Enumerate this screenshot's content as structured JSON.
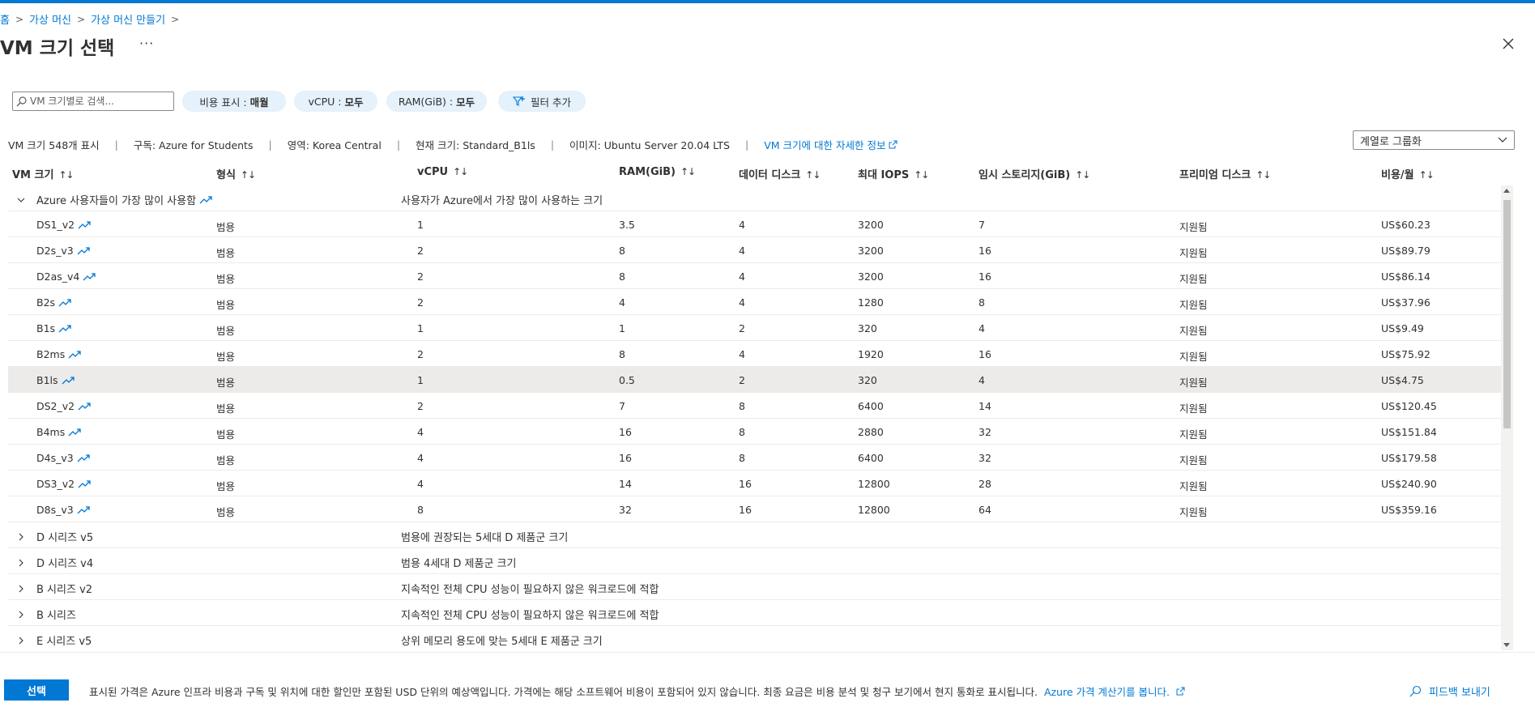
{
  "breadcrumb": {
    "items": [
      "홈",
      "가상 머신",
      "가상 머신 만들기"
    ]
  },
  "title": "VM 크기 선택",
  "more_label": "···",
  "search": {
    "placeholder": "VM 크기별로 검색...",
    "value": ""
  },
  "filters": {
    "cost": {
      "label": "비용 표시 :",
      "value": "매월"
    },
    "vcpu": {
      "label": "vCPU :",
      "value": "모두"
    },
    "ram": {
      "label": "RAM(GiB) :",
      "value": "모두"
    },
    "add": "필터 추가"
  },
  "info": {
    "count": "VM 크기 548개 표시",
    "subscription": "구독: Azure for Students",
    "region": "영역: Korea Central",
    "current": "현재 크기: Standard_B1ls",
    "image": "이미지: Ubuntu Server 20.04 LTS",
    "link": "VM 크기에 대한 자세한 정보"
  },
  "groupby": {
    "value": "계열로 그룹화"
  },
  "columns": [
    "VM 크기",
    "형식",
    "vCPU",
    "RAM(GiB)",
    "데이터 디스크",
    "최대 IOPS",
    "임시 스토리지(GiB)",
    "프리미엄 디스크",
    "비용/월"
  ],
  "popular_group": {
    "name": "Azure 사용자들이 가장 많이 사용함",
    "description": "사용자가 Azure에서 가장 많이 사용하는 크기",
    "rows": [
      {
        "size": "DS1_v2",
        "type": "범용",
        "vcpu": "1",
        "ram": "3.5",
        "disks": "4",
        "iops": "3200",
        "temp": "7",
        "premium": "지원됨",
        "cost": "US$60.23",
        "selected": false
      },
      {
        "size": "D2s_v3",
        "type": "범용",
        "vcpu": "2",
        "ram": "8",
        "disks": "4",
        "iops": "3200",
        "temp": "16",
        "premium": "지원됨",
        "cost": "US$89.79",
        "selected": false
      },
      {
        "size": "D2as_v4",
        "type": "범용",
        "vcpu": "2",
        "ram": "8",
        "disks": "4",
        "iops": "3200",
        "temp": "16",
        "premium": "지원됨",
        "cost": "US$86.14",
        "selected": false
      },
      {
        "size": "B2s",
        "type": "범용",
        "vcpu": "2",
        "ram": "4",
        "disks": "4",
        "iops": "1280",
        "temp": "8",
        "premium": "지원됨",
        "cost": "US$37.96",
        "selected": false
      },
      {
        "size": "B1s",
        "type": "범용",
        "vcpu": "1",
        "ram": "1",
        "disks": "2",
        "iops": "320",
        "temp": "4",
        "premium": "지원됨",
        "cost": "US$9.49",
        "selected": false
      },
      {
        "size": "B2ms",
        "type": "범용",
        "vcpu": "2",
        "ram": "8",
        "disks": "4",
        "iops": "1920",
        "temp": "16",
        "premium": "지원됨",
        "cost": "US$75.92",
        "selected": false
      },
      {
        "size": "B1ls",
        "type": "범용",
        "vcpu": "1",
        "ram": "0.5",
        "disks": "2",
        "iops": "320",
        "temp": "4",
        "premium": "지원됨",
        "cost": "US$4.75",
        "selected": true
      },
      {
        "size": "DS2_v2",
        "type": "범용",
        "vcpu": "2",
        "ram": "7",
        "disks": "8",
        "iops": "6400",
        "temp": "14",
        "premium": "지원됨",
        "cost": "US$120.45",
        "selected": false
      },
      {
        "size": "B4ms",
        "type": "범용",
        "vcpu": "4",
        "ram": "16",
        "disks": "8",
        "iops": "2880",
        "temp": "32",
        "premium": "지원됨",
        "cost": "US$151.84",
        "selected": false
      },
      {
        "size": "D4s_v3",
        "type": "범용",
        "vcpu": "4",
        "ram": "16",
        "disks": "8",
        "iops": "6400",
        "temp": "32",
        "premium": "지원됨",
        "cost": "US$179.58",
        "selected": false
      },
      {
        "size": "DS3_v2",
        "type": "범용",
        "vcpu": "4",
        "ram": "14",
        "disks": "16",
        "iops": "12800",
        "temp": "28",
        "premium": "지원됨",
        "cost": "US$240.90",
        "selected": false
      },
      {
        "size": "D8s_v3",
        "type": "범용",
        "vcpu": "8",
        "ram": "32",
        "disks": "16",
        "iops": "12800",
        "temp": "64",
        "premium": "지원됨",
        "cost": "US$359.16",
        "selected": false
      }
    ]
  },
  "collapsed_groups": [
    {
      "name": "D 시리즈 v5",
      "description": "범용에 권장되는 5세대 D 제품군 크기"
    },
    {
      "name": "D 시리즈 v4",
      "description": "범용 4세대 D 제품군 크기"
    },
    {
      "name": "B 시리즈 v2",
      "description": "지속적인 전체 CPU 성능이 필요하지 않은 워크로드에 적합"
    },
    {
      "name": "B 시리즈",
      "description": "지속적인 전체 CPU 성능이 필요하지 않은 워크로드에 적합"
    },
    {
      "name": "E 시리즈 v5",
      "description": "상위 메모리 용도에 맞는 5세대 E 제품군 크기"
    }
  ],
  "footer": {
    "select_label": "선택",
    "notice": "표시된 가격은 Azure 인프라 비용과 구독 및 위치에 대한 할인만 포함된 USD 단위의 예상액입니다. 가격에는 해당 소프트웨어 비용이 포함되어 있지 않습니다. 최종 요금은 비용 분석 및 청구 보기에서 현지 통화로 표시됩니다.",
    "calculator_link": "Azure 가격 계산기를 봅니다.",
    "feedback": "피드백 보내기"
  },
  "colors": {
    "accent": "#0078d4",
    "pill_bg": "#e5f1fb",
    "selected_row": "#edebe9"
  },
  "icons": [
    "search-icon",
    "close-icon",
    "filter-add-icon",
    "external-link-icon",
    "chevron-down-icon",
    "chevron-right-icon",
    "trending-icon",
    "feedback-icon"
  ]
}
